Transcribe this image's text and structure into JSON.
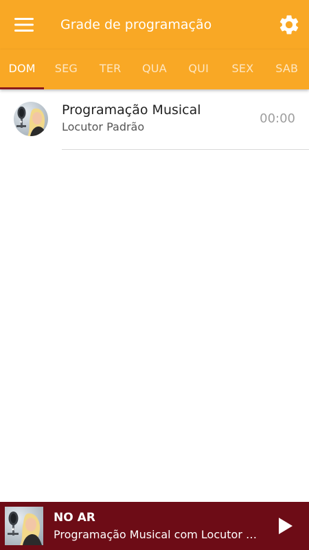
{
  "toolbar": {
    "title": "Grade de programação",
    "menu_icon": "hamburger-menu-icon",
    "settings_icon": "gear-icon",
    "background_color": "#f9a825"
  },
  "tabs": [
    {
      "label": "DOM",
      "active": true
    },
    {
      "label": "SEG",
      "active": false
    },
    {
      "label": "TER",
      "active": false
    },
    {
      "label": "QUA",
      "active": false
    },
    {
      "label": "QUI",
      "active": false
    },
    {
      "label": "SEX",
      "active": false
    },
    {
      "label": "SAB",
      "active": false
    }
  ],
  "tab_indicator_color": "#8b1a1a",
  "schedule": [
    {
      "title": "Programação Musical",
      "host": "Locutor Padrão",
      "time": "00:00",
      "avatar_icon": "host-avatar-photo"
    }
  ],
  "player": {
    "status": "NO AR",
    "track": "Programação Musical com Locutor Padrão",
    "play_icon": "play-icon",
    "background_color": "#6d0c16"
  }
}
